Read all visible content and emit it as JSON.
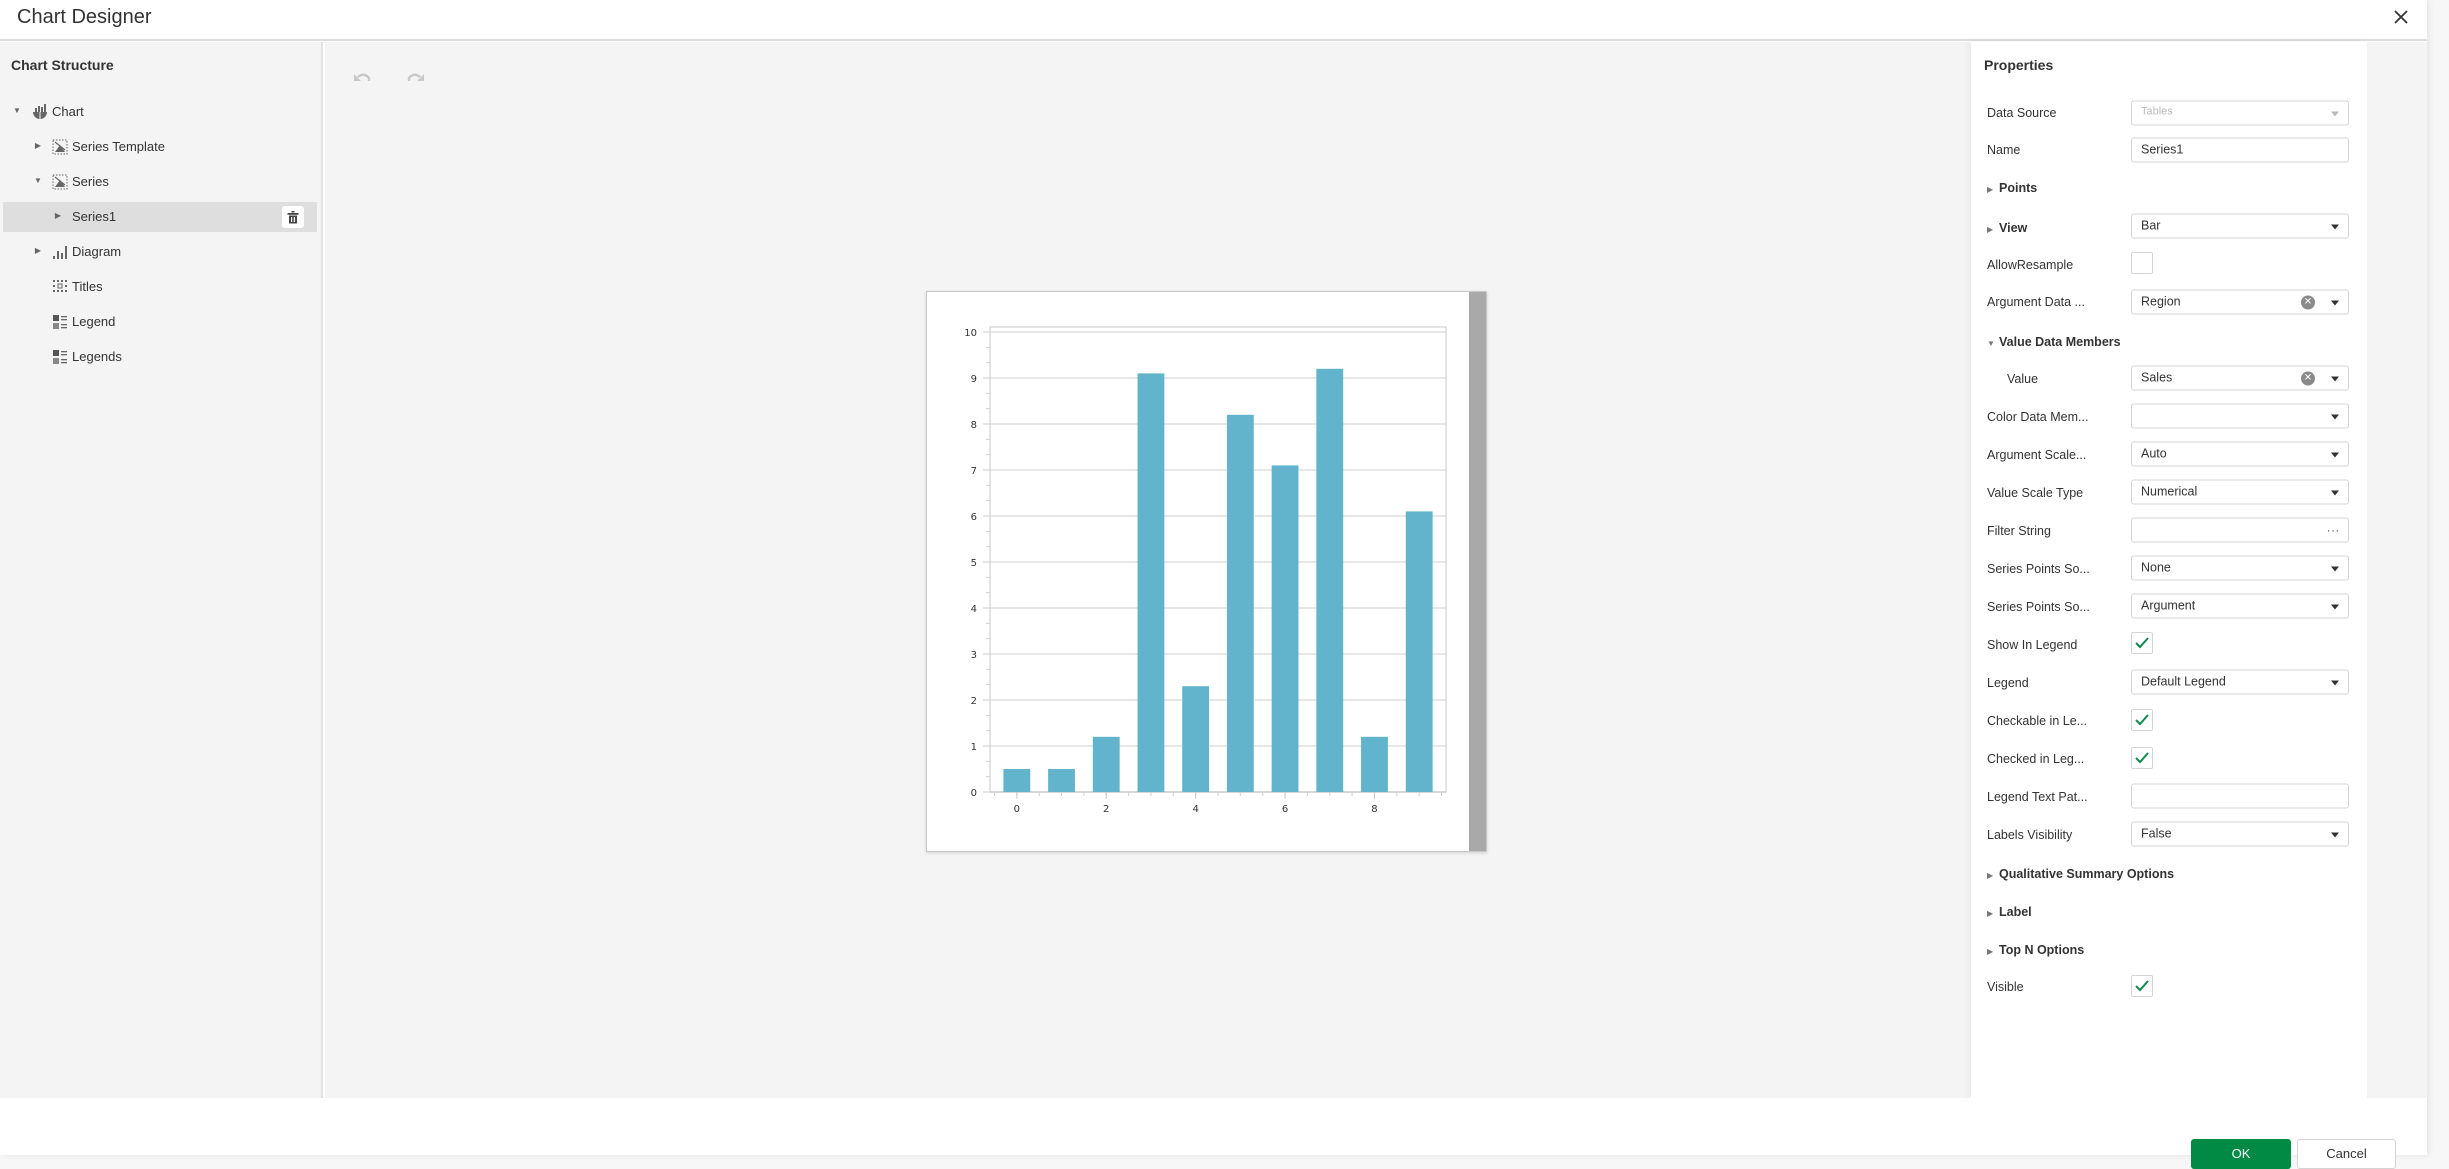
{
  "dialog": {
    "title": "Chart Designer",
    "close_icon": "close-icon"
  },
  "structure": {
    "title": "Chart Structure",
    "items": [
      {
        "label": "Chart",
        "icon": "chart-icon",
        "expander": "expanded"
      },
      {
        "label": "Series Template",
        "icon": "series-icon",
        "expander": "collapsed"
      },
      {
        "label": "Series",
        "icon": "series-icon",
        "expander": "expanded"
      },
      {
        "label": "Series1",
        "icon": "",
        "expander": "collapsed",
        "selected": true,
        "action_icon": "trash-icon"
      },
      {
        "label": "Diagram",
        "icon": "diagram-icon",
        "expander": "collapsed"
      },
      {
        "label": "Titles",
        "icon": "titles-icon",
        "expander": "none"
      },
      {
        "label": "Legend",
        "icon": "legend-icon",
        "expander": "none"
      },
      {
        "label": "Legends",
        "icon": "legend-icon",
        "expander": "none"
      }
    ]
  },
  "toolbar": {
    "undo_icon": "undo-icon",
    "redo_icon": "redo-icon"
  },
  "properties": {
    "title": "Properties",
    "data_source": {
      "label": "Data Source",
      "value": "Tables"
    },
    "name": {
      "label": "Name",
      "value": "Series1"
    },
    "points": {
      "label": "Points"
    },
    "view": {
      "label": "View",
      "value": "Bar"
    },
    "allow_resample": {
      "label": "AllowResample",
      "checked": false
    },
    "argument_data_member": {
      "label": "Argument Data ...",
      "value": "Region"
    },
    "value_data_members": {
      "label": "Value Data Members"
    },
    "value": {
      "label": "Value",
      "value": "Sales"
    },
    "color_data_member": {
      "label": "Color Data Mem...",
      "value": ""
    },
    "argument_scale_type": {
      "label": "Argument Scale...",
      "value": "Auto"
    },
    "value_scale_type": {
      "label": "Value Scale Type",
      "value": "Numerical"
    },
    "filter_string": {
      "label": "Filter String",
      "value": "",
      "button": "..."
    },
    "series_points_sorting": {
      "label": "Series Points So...",
      "value": "None"
    },
    "series_points_sorting_key": {
      "label": "Series Points So...",
      "value": "Argument"
    },
    "show_in_legend": {
      "label": "Show In Legend",
      "checked": true
    },
    "legend": {
      "label": "Legend",
      "value": "Default Legend"
    },
    "checkable_in_legend": {
      "label": "Checkable in Le...",
      "checked": true
    },
    "checked_in_legend": {
      "label": "Checked in Leg...",
      "checked": true
    },
    "legend_text_pattern": {
      "label": "Legend Text Pat...",
      "value": ""
    },
    "labels_visibility": {
      "label": "Labels Visibility",
      "value": "False"
    },
    "qualitative_summary_options": {
      "label": "Qualitative Summary Options"
    },
    "label": {
      "label": "Label"
    },
    "top_n_options": {
      "label": "Top N Options"
    },
    "visible": {
      "label": "Visible",
      "checked": true
    }
  },
  "footer": {
    "ok_label": "OK",
    "cancel_label": "Cancel"
  },
  "colors": {
    "accent": "#008a43",
    "bar": "#62b3cc",
    "check": "#0f8a4f"
  },
  "chart_data": {
    "type": "bar",
    "title": "",
    "xlabel": "",
    "ylabel": "",
    "x": [
      0,
      1,
      2,
      3,
      4,
      5,
      6,
      7,
      8,
      9
    ],
    "values": [
      0.5,
      0.5,
      1.2,
      9.1,
      2.3,
      8.2,
      7.1,
      9.2,
      1.2,
      6.1
    ],
    "series": [
      {
        "name": "Series1",
        "values": [
          0.5,
          0.5,
          1.2,
          9.1,
          2.3,
          8.2,
          7.1,
          9.2,
          1.2,
          6.1
        ]
      }
    ],
    "ylim": [
      0,
      10
    ],
    "xlim": [
      -0.6,
      9.6
    ],
    "y_ticks": [
      0,
      1,
      2,
      3,
      4,
      5,
      6,
      7,
      8,
      9,
      10
    ],
    "x_ticks": [
      0,
      2,
      4,
      6,
      8
    ],
    "grid": true,
    "legend": "none"
  }
}
